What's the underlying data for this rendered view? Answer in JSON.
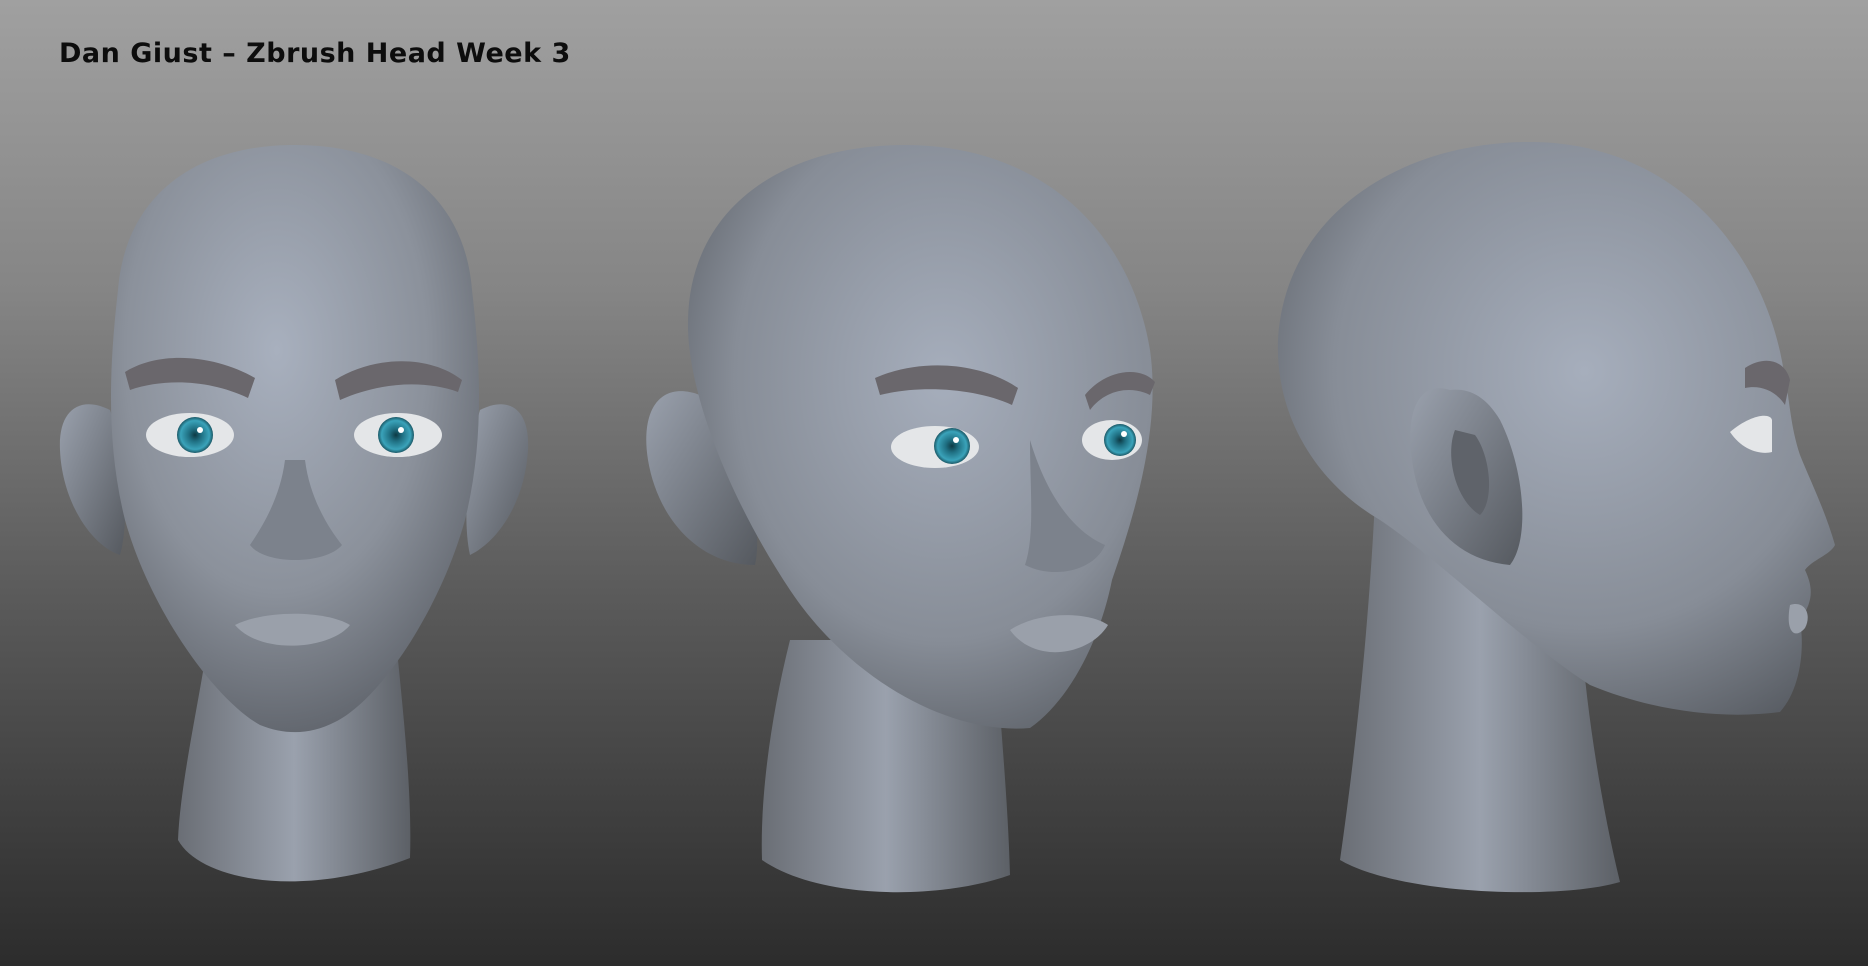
{
  "title": "Dan Giust – Zbrush Head Week 3",
  "views": [
    {
      "name": "front"
    },
    {
      "name": "three-quarter"
    },
    {
      "name": "profile"
    }
  ],
  "colors": {
    "skin": "#8e949f",
    "skin_light": "#a5adbb",
    "skin_shadow": "#5a5e66",
    "brow": "#6a676c",
    "iris": "#2a8aa0",
    "sclera": "#e4e6e8"
  }
}
